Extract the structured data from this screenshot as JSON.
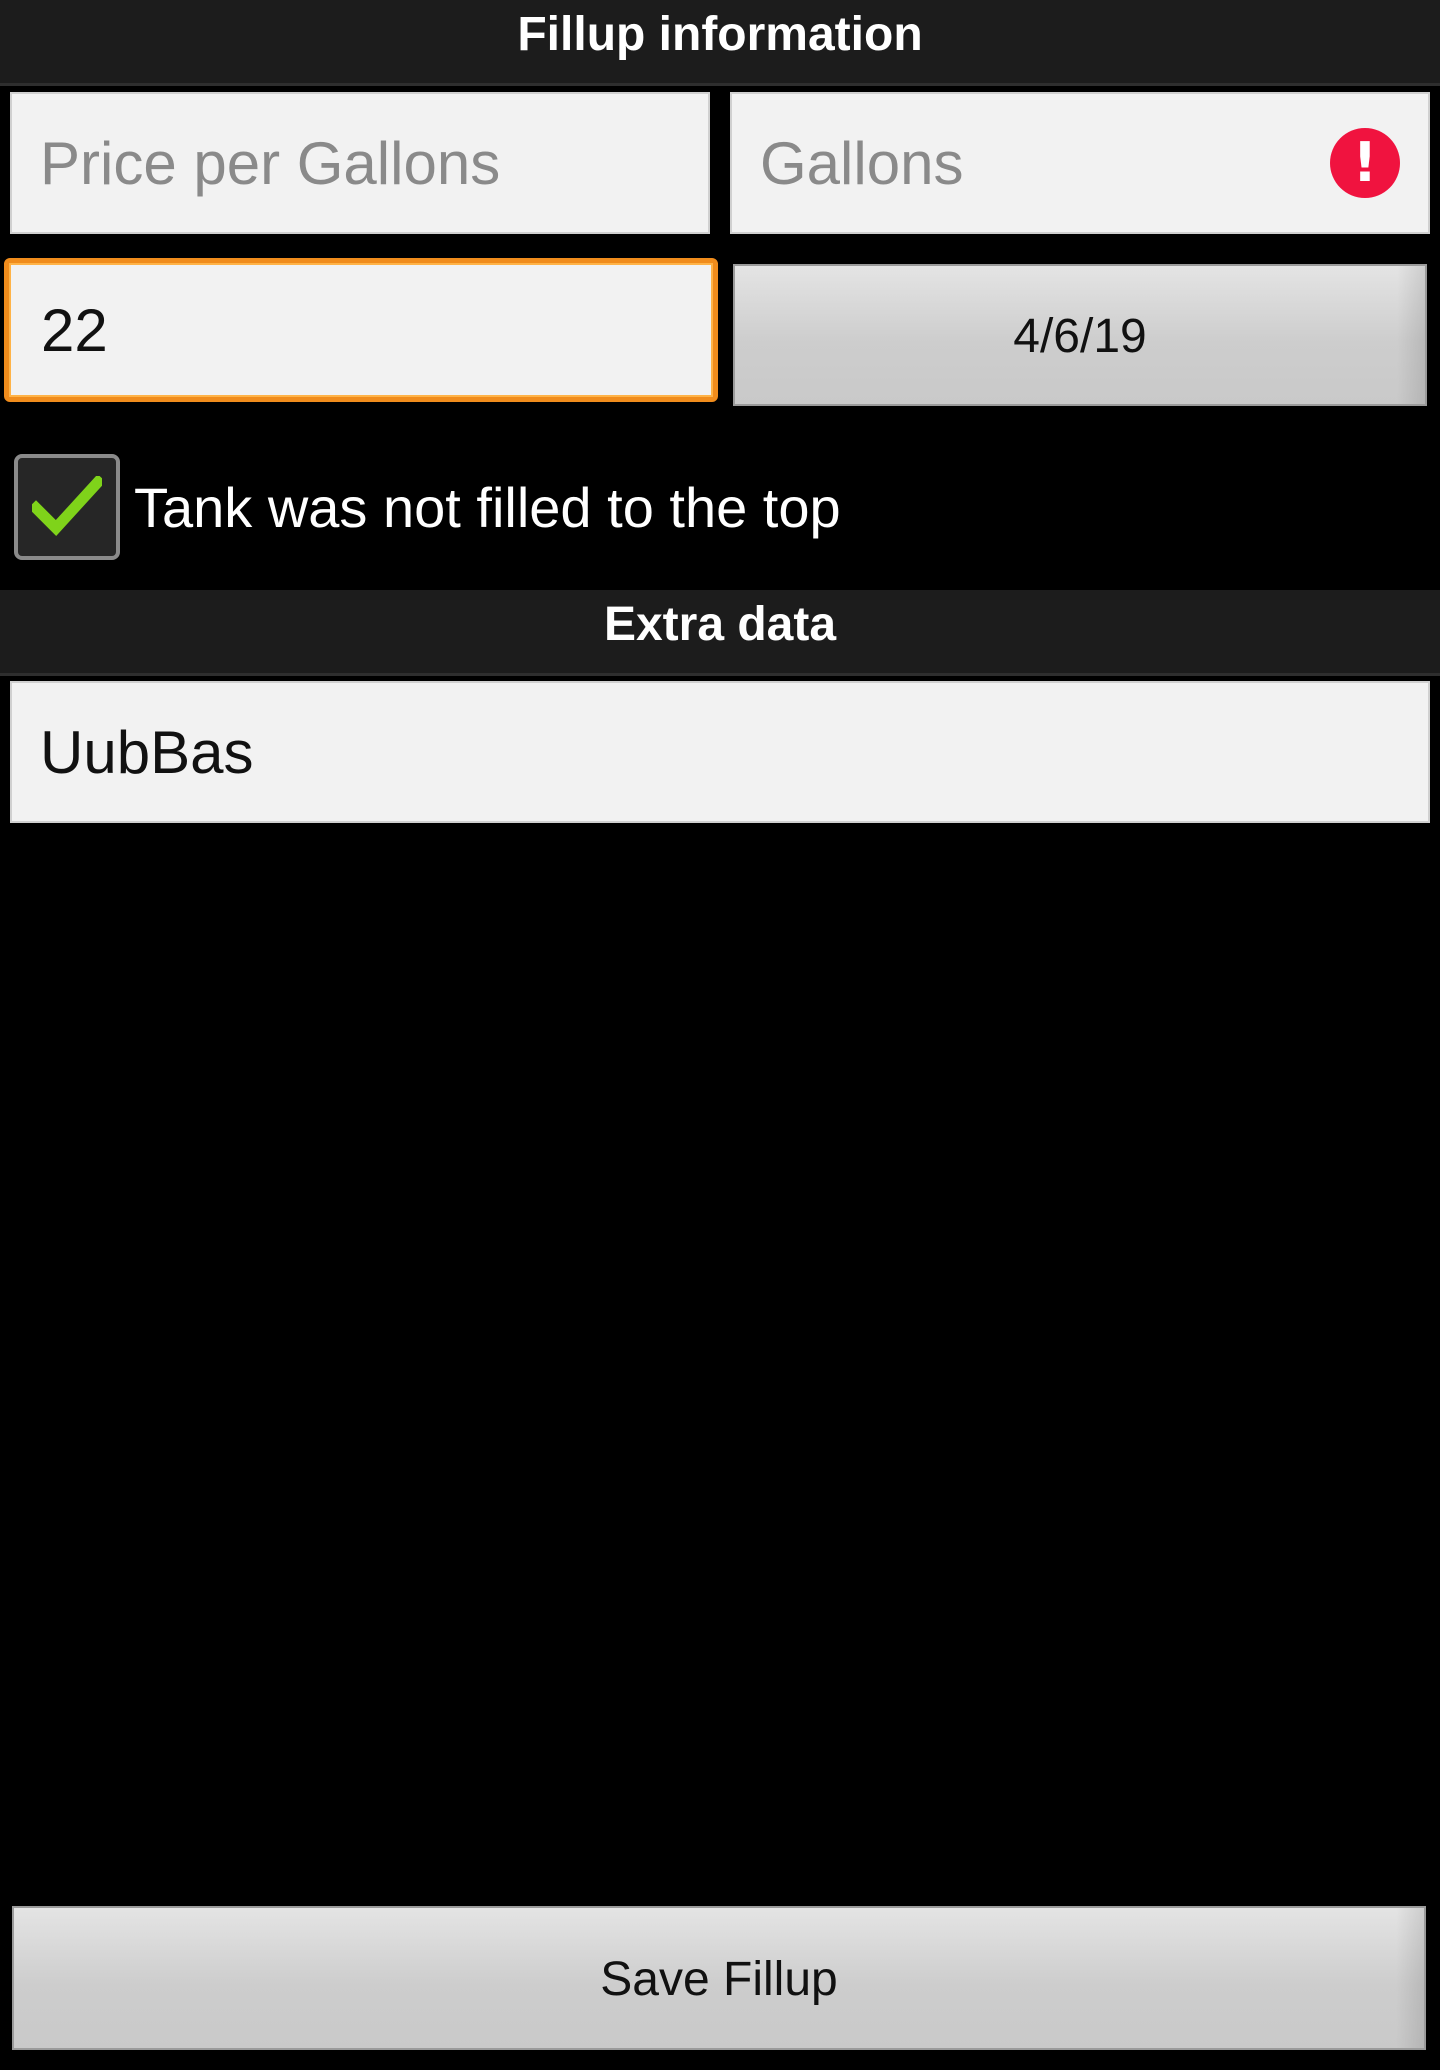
{
  "header": {
    "fillup_title": "Fillup information"
  },
  "fields": {
    "price_per_gallon": {
      "value": "",
      "placeholder": "Price per Gallons"
    },
    "gallons": {
      "value": "",
      "placeholder": "Gallons",
      "error_icon": "error-exclamation-icon",
      "error_color": "#f0133f"
    },
    "odometer": {
      "value": "22"
    }
  },
  "date_button": {
    "label": "4/6/19"
  },
  "partial_fill": {
    "label": "Tank was not filled to the top",
    "checked": true,
    "check_color": "#7fd31a"
  },
  "extra": {
    "title": "Extra data",
    "notes": {
      "value": "UubBas"
    }
  },
  "actions": {
    "save_label": "Save Fillup"
  },
  "colors": {
    "focus_border": "#f08c1c",
    "background": "#000000",
    "header_bg": "#1c1c1c"
  }
}
